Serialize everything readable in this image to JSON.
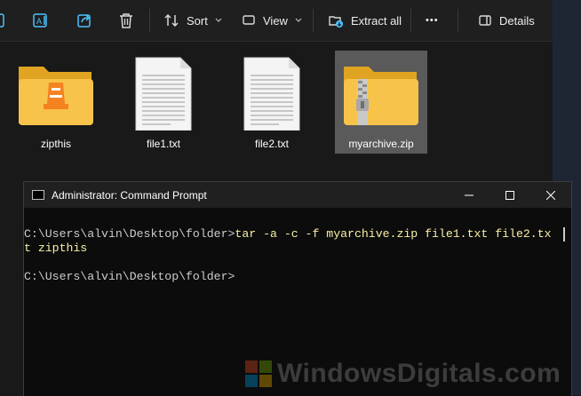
{
  "explorer": {
    "toolbar": {
      "sort_label": "Sort",
      "view_label": "View",
      "extract_label": "Extract all",
      "more_label": "•••",
      "details_label": "Details"
    },
    "items": [
      {
        "name": "zipthis",
        "icon": "folder-vlc-icon"
      },
      {
        "name": "file1.txt",
        "icon": "text-file-icon"
      },
      {
        "name": "file2.txt",
        "icon": "text-file-icon"
      },
      {
        "name": "myarchive.zip",
        "icon": "zip-folder-icon",
        "selected": true
      }
    ]
  },
  "cmd": {
    "title": "Administrator: Command Prompt",
    "lines": {
      "prompt1": "C:\\Users\\alvin\\Desktop\\folder>",
      "command_part1": "tar -a -c -f myarchive.zip file1.txt file2.tx",
      "command_part2": "t zipthis",
      "prompt2": "C:\\Users\\alvin\\Desktop\\folder>"
    }
  },
  "watermark": {
    "text": "WindowsDigitals.com"
  },
  "colors": {
    "accent_blue": "#4cc2ff",
    "prompt_yellow": "#f9f1a5",
    "folder_yellow": "#f8c34a",
    "selected_bg": "#5a5a5a"
  }
}
